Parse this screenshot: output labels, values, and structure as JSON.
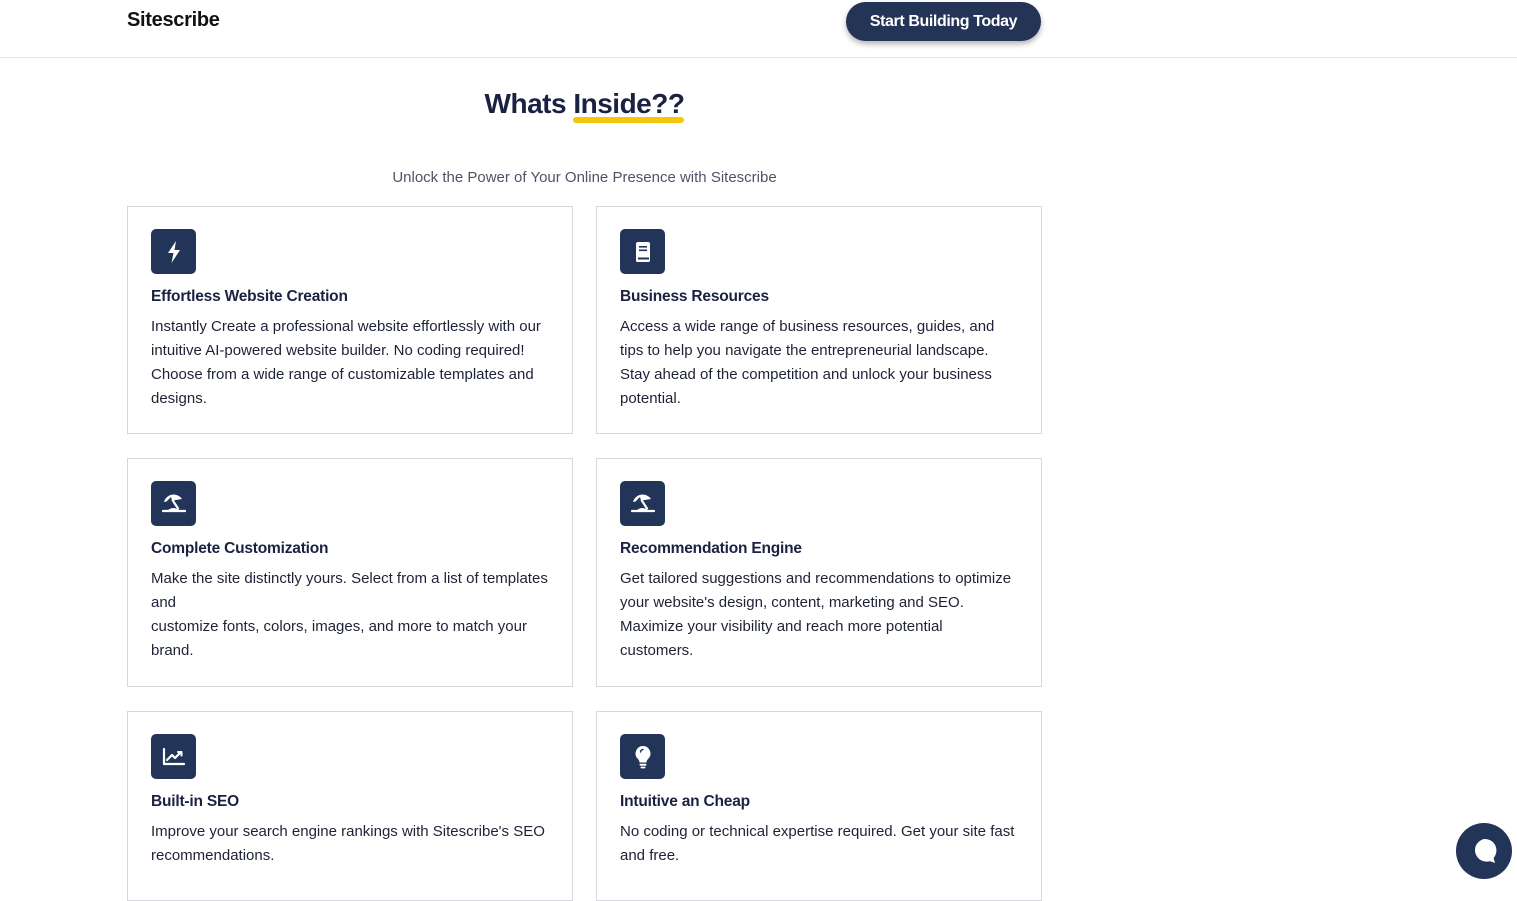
{
  "header": {
    "brand": "Sitescribe",
    "cta_label": "Start Building Today"
  },
  "section": {
    "title_prefix": "Whats ",
    "title_highlight": "Inside??",
    "subtitle": "Unlock the Power of Your Online Presence with Sitescribe"
  },
  "colors": {
    "primary": "#223559",
    "highlight": "#f5c60a",
    "text": "#1b2141"
  },
  "features": [
    {
      "icon": "lightning-icon",
      "title": "Effortless Website Creation",
      "body": "Instantly Create a professional website effortlessly with our intuitive AI-powered website builder. No coding required! Choose from a wide range of customizable templates and designs."
    },
    {
      "icon": "book-icon",
      "title": "Business Resources",
      "body": "Access a wide range of business resources, guides, and tips to help you navigate the entrepreneurial landscape. Stay ahead of the competition and unlock your business potential."
    },
    {
      "icon": "umbrella-beach-icon",
      "title": "Complete Customization",
      "body_line1": "Make the site distinctly yours. Select from a list of templates and",
      "body_line2": "customize fonts, colors, images, and more to match your brand."
    },
    {
      "icon": "umbrella-beach-icon",
      "title": "Recommendation Engine",
      "body": "Get tailored suggestions and recommendations to optimize your website's design, content, marketing and SEO. Maximize your visibility and reach more potential customers."
    },
    {
      "icon": "line-chart-icon",
      "title": "Built-in SEO",
      "body": "Improve your search engine rankings with Sitescribe's SEO recommendations."
    },
    {
      "icon": "lightbulb-icon",
      "title": "Intuitive an Cheap",
      "body": "No coding or technical expertise required. Get your site fast and free."
    }
  ],
  "chat": {
    "icon": "chat-bubble-icon"
  }
}
